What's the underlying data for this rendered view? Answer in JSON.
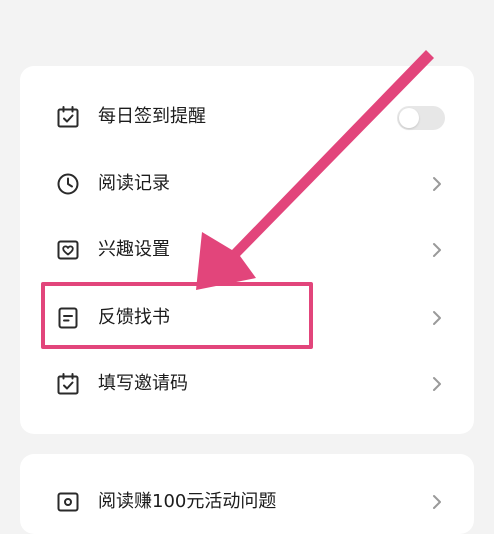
{
  "settings_list": {
    "items": [
      {
        "label": "每日签到提醒",
        "icon": "calendar-check-icon",
        "control": "toggle",
        "toggle_on": false
      },
      {
        "label": "阅读记录",
        "icon": "clock-icon",
        "control": "chevron"
      },
      {
        "label": "兴趣设置",
        "icon": "heart-icon",
        "control": "chevron"
      },
      {
        "label": "反馈找书",
        "icon": "document-icon",
        "control": "chevron"
      },
      {
        "label": "填写邀请码",
        "icon": "calendar-check-icon",
        "control": "chevron"
      }
    ]
  },
  "second_list": {
    "items": [
      {
        "label": "阅读赚100元活动问题",
        "icon": "activity-icon",
        "control": "chevron"
      }
    ]
  },
  "annotation": {
    "highlighted_item": "反馈找书",
    "color": "#e2457b"
  },
  "colors": {
    "background": "#f3f3f3",
    "card": "#ffffff",
    "text": "#1c1c1c",
    "icon": "#2a2a2a",
    "chevron": "#9a9a9a",
    "toggle_off": "#e7e7e7"
  }
}
